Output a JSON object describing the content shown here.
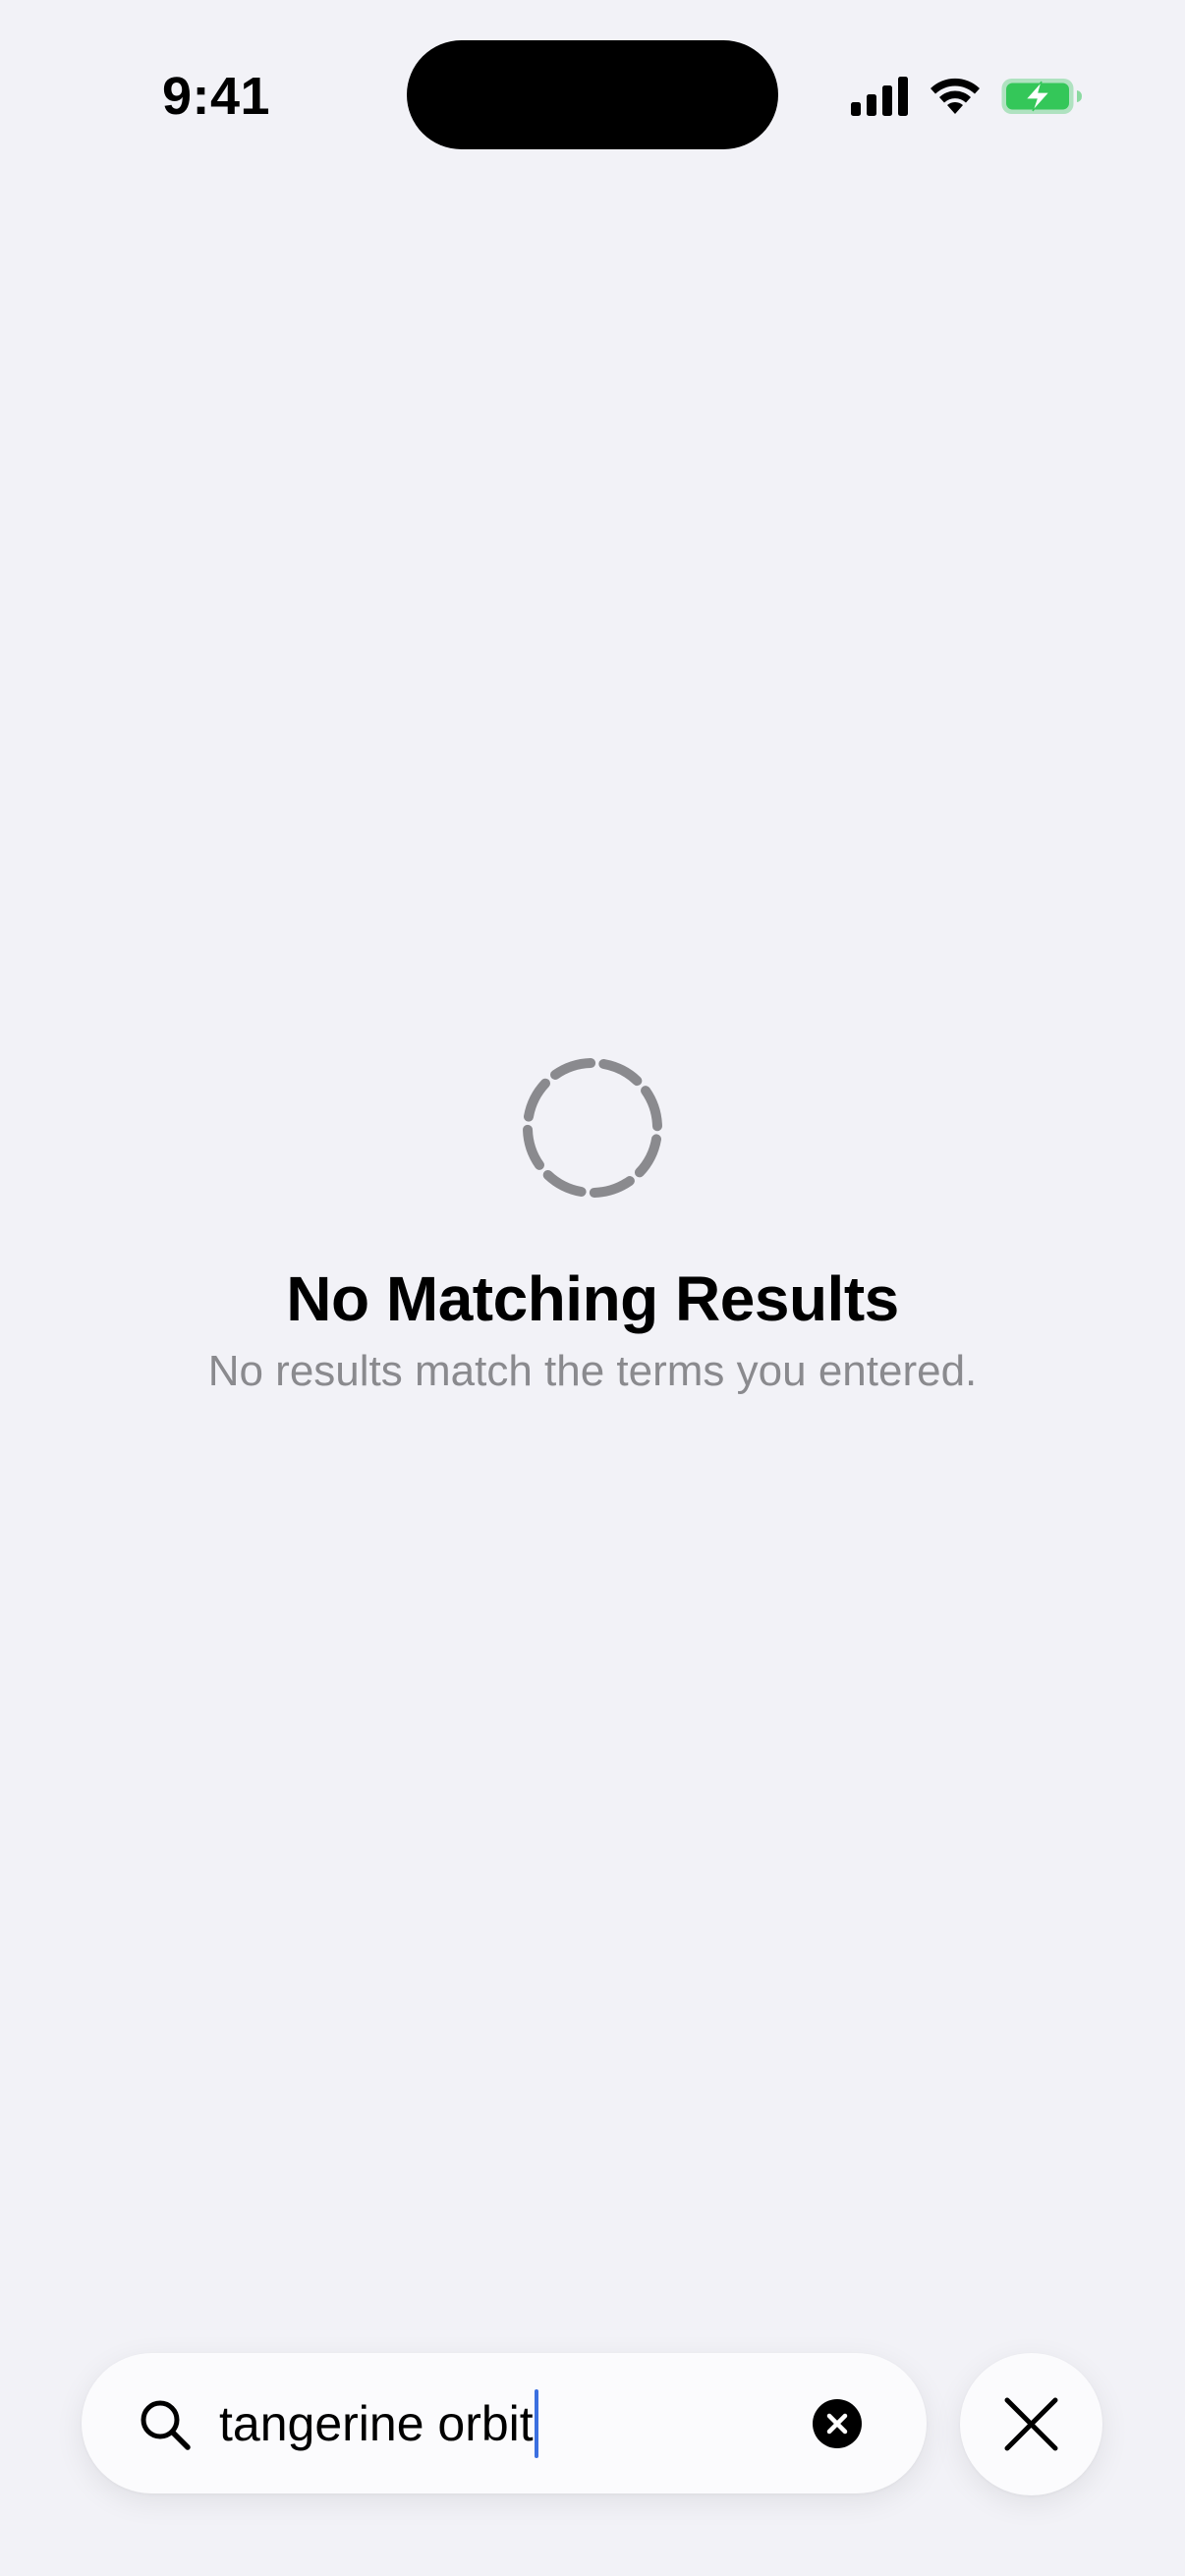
{
  "status_bar": {
    "time": "9:41",
    "icons": [
      "cellular-signal-icon",
      "wifi-icon",
      "battery-charging-icon"
    ],
    "battery_color": "#34c759"
  },
  "empty_state": {
    "icon": "loading-spinner-icon",
    "title": "No Matching Results",
    "subtitle": "No results match the terms you entered."
  },
  "search": {
    "icon": "search-icon",
    "query": "tangerine orbit",
    "clear_icon": "clear-circle-icon",
    "cursor_color": "#3b6fe0"
  },
  "close_button": {
    "icon": "close-icon"
  },
  "colors": {
    "background": "#f2f2f7",
    "secondary_text": "#8a8a8e",
    "field_background": "#fbfbfd"
  }
}
